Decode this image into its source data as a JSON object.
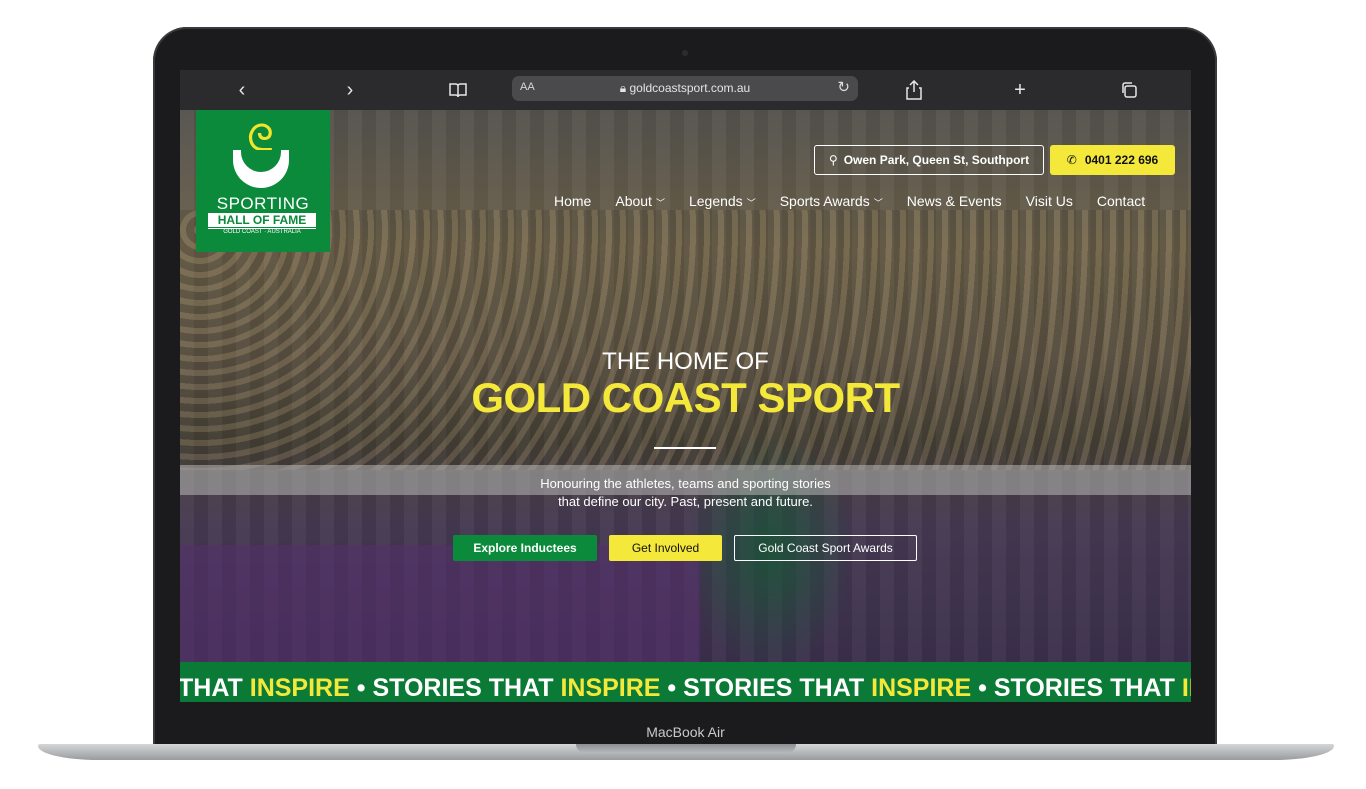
{
  "device": {
    "label": "MacBook Air"
  },
  "browser": {
    "back_icon": "chevron-left-icon",
    "forward_icon": "chevron-right-icon",
    "reader_icon": "book-icon",
    "text_size_label": "AA",
    "url": "goldcoastsport.com.au",
    "reload_icon": "reload-icon",
    "share_icon": "share-icon",
    "new_tab_icon": "plus-icon",
    "tabs_icon": "tabs-icon"
  },
  "site": {
    "logo": {
      "line1": "SPORTING",
      "line2": "HALL OF FAME",
      "line3": "GOLD COAST · AUSTRALIA"
    },
    "location": "Owen Park, Queen St, Southport",
    "phone": "0401 222 696",
    "nav": [
      {
        "label": "Home",
        "dropdown": false
      },
      {
        "label": "About",
        "dropdown": true
      },
      {
        "label": "Legends",
        "dropdown": true
      },
      {
        "label": "Sports Awards",
        "dropdown": true
      },
      {
        "label": "News & Events",
        "dropdown": false
      },
      {
        "label": "Visit Us",
        "dropdown": false
      },
      {
        "label": "Contact",
        "dropdown": false
      }
    ],
    "hero": {
      "kicker": "THE HOME OF",
      "title": "GOLD COAST SPORT",
      "subtitle_line1": "Honouring the athletes, teams and sporting stories",
      "subtitle_line2": "that define our city. Past, present and future.",
      "buttons": [
        "Explore Inductees",
        "Get Involved",
        "Gold Coast Sport Awards"
      ]
    },
    "ticker": {
      "word_white": "STORIES THAT",
      "word_yellow": "INSPIRE",
      "lead_white": "THAT",
      "separator": "•",
      "trail": "STORIES THAT"
    },
    "colors": {
      "green": "#0b8a3b",
      "yellow": "#f4e83a"
    }
  }
}
